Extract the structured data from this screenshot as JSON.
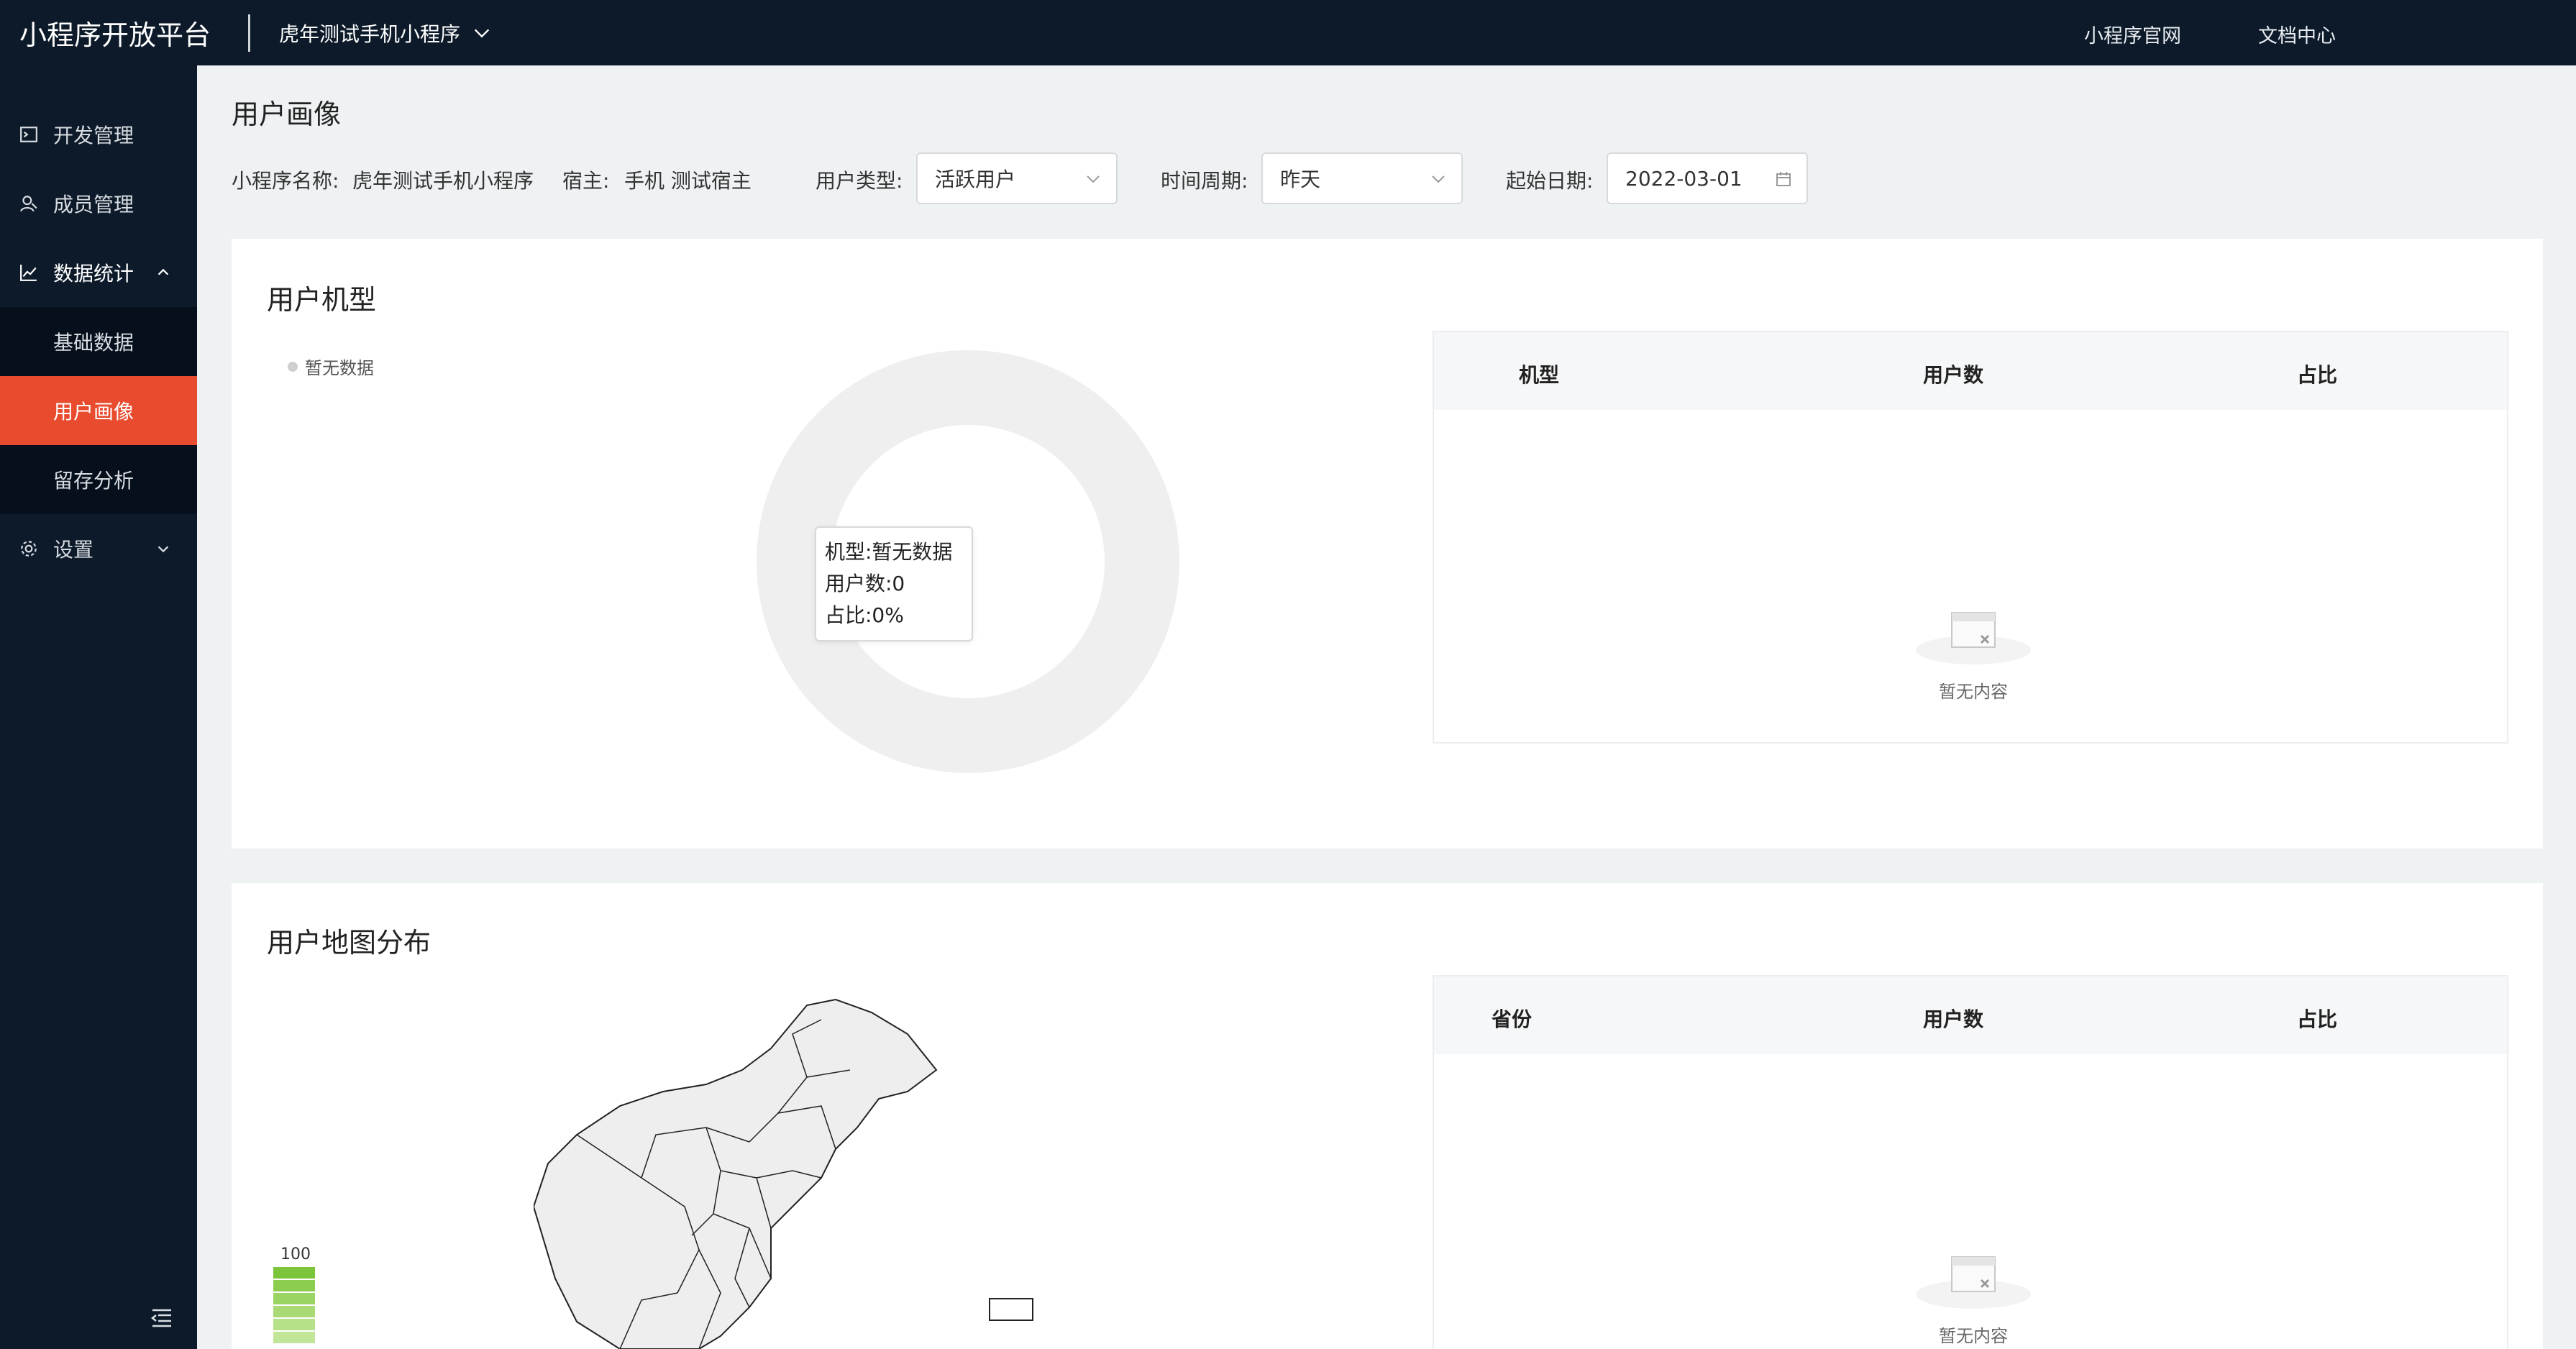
{
  "header": {
    "brand": "小程序开放平台",
    "app_name": "虎年测试手机小程序",
    "links": [
      "小程序官网",
      "文档中心"
    ]
  },
  "sidebar": {
    "items": [
      {
        "label": "开发管理",
        "icon": "terminal-icon"
      },
      {
        "label": "成员管理",
        "icon": "member-icon"
      },
      {
        "label": "数据统计",
        "icon": "chart-line-icon",
        "expanded": true,
        "children": [
          "基础数据",
          "用户画像",
          "留存分析"
        ],
        "active_child": "用户画像"
      },
      {
        "label": "设置",
        "icon": "gear-icon",
        "expanded": false
      }
    ]
  },
  "page": {
    "title": "用户画像",
    "filters": {
      "app_name_label": "小程序名称:",
      "app_name_value": "虎年测试手机小程序",
      "host_label": "宿主:",
      "host_value": "手机  测试宿主",
      "user_type_label": "用户类型:",
      "user_type_value": "活跃用户",
      "period_label": "时间周期:",
      "period_value": "昨天",
      "start_date_label": "起始日期:",
      "start_date_value": "2022-03-01"
    }
  },
  "device_card": {
    "title": "用户机型",
    "legend": "暂无数据",
    "tooltip": {
      "line1": "机型:暂无数据",
      "line2": "用户数:0",
      "line3": "占比:0%"
    },
    "table_headers": [
      "机型",
      "用户数",
      "占比"
    ],
    "empty_text": "暂无内容"
  },
  "map_card": {
    "title": "用户地图分布",
    "scale_max": "100",
    "table_headers": [
      "省份",
      "用户数",
      "占比"
    ],
    "empty_text": "暂无内容"
  },
  "colors": {
    "sidebar_bg": "#0c1a2a",
    "active": "#e84b2e",
    "scale_green": "#7cc43a"
  }
}
